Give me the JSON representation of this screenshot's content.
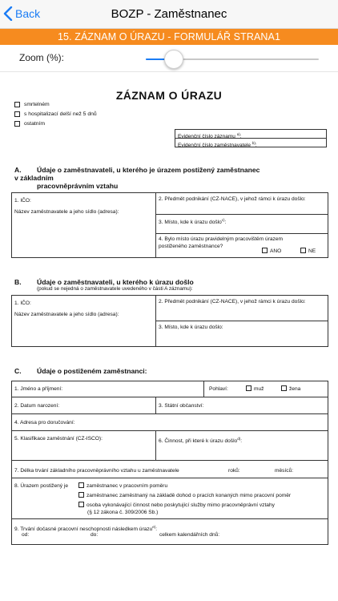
{
  "nav": {
    "back_label": "Back",
    "title": "BOZP - Zaměstnanec"
  },
  "banner": {
    "title": "15. ZÁZNAM O ÚRAZU - FORMULÁŘ STRANA1",
    "color": "#f68b1f"
  },
  "zoom": {
    "label": "Zoom (%):",
    "value_fraction": 0.16
  },
  "form": {
    "title": "ZÁZNAM O ÚRAZU",
    "checks": [
      "smrtelném",
      "s hospitalizací delší než 5 dnů",
      "ostatním"
    ],
    "evid_record": "Evidenční číslo záznamu",
    "evid_employee": "Evidenční číslo zaměstnavatele",
    "sup_a": "a)",
    "sup_b": "b)",
    "sup_c": "c)",
    "sup_d": "d)",
    "sup_e": "e)",
    "sec_a": {
      "letter": "A.",
      "head1": "Údaje o zaměstnavateli, u kterého je úrazem postižený zaměstnanec",
      "head2": "v základním",
      "head3": "pracovněprávním vztahu",
      "ico": "1. IČO:",
      "name": "Název zaměstnavatele a jeho sídlo (adresa):",
      "f2": "2. Předmět podnikání (CZ-NACE), v jehož rámci k úrazu došlo:",
      "f3": "3. Místo, kde k úrazu došlo",
      "f4a": "4. Bylo místo úrazu pravidelným pracovištěm úrazem",
      "f4b": "postiženého zaměstnance?",
      "ano": "ANO",
      "ne": "NE"
    },
    "sec_b": {
      "letter": "B.",
      "head": "Údaje o zaměstnavateli, u kterého k úrazu došlo",
      "sub": "(pokud se nejedná o zaměstnavatele uvedeného v části A záznamu):",
      "ico": "1. IČO:",
      "name": "Název zaměstnavatele a jeho sídlo (adresa):",
      "f2": "2. Předmět podnikání (CZ-NACE), v jehož rámci k úrazu došlo:",
      "f3": "3. Místo, kde k úrazu došlo:"
    },
    "sec_c": {
      "letter": "C.",
      "head": "Údaje o postiženém zaměstnanci:",
      "f1": "1. Jméno a příjmení:",
      "gender": "Pohlaví:",
      "male": "muž",
      "female": "žena",
      "f2": "2. Datum narození:",
      "f3": "3. Státní občanství:",
      "f4": "4. Adresa pro doručování:",
      "f5": "5. Klasifikace zaměstnání (CZ-ISCO):",
      "f6": "6. Činnost, při které k úrazu došlo",
      "f7": "7. Délka trvání základního pracovněprávního vztahu u zaměstnavatele",
      "roku": "roků:",
      "mesicu": "měsíců:",
      "f8": "8. Úrazem postižený je",
      "f8a": "zaměstnanec v pracovním poměru",
      "f8b": "zaměstnanec zaměstnaný na základě dohod o pracích konaných mimo pracovní poměr",
      "f8c1": "osoba vykonávající činnost nebo poskytující služby mimo pracovněprávní vztahy",
      "f8c2": "(§ 12 zákona č. 309/2006 Sb.)",
      "f9": "9. Trvání dočasné pracovní neschopnosti následkem úrazu",
      "od": "od:",
      "do": "do:",
      "days": "celkem kalendářních dnů:"
    }
  }
}
